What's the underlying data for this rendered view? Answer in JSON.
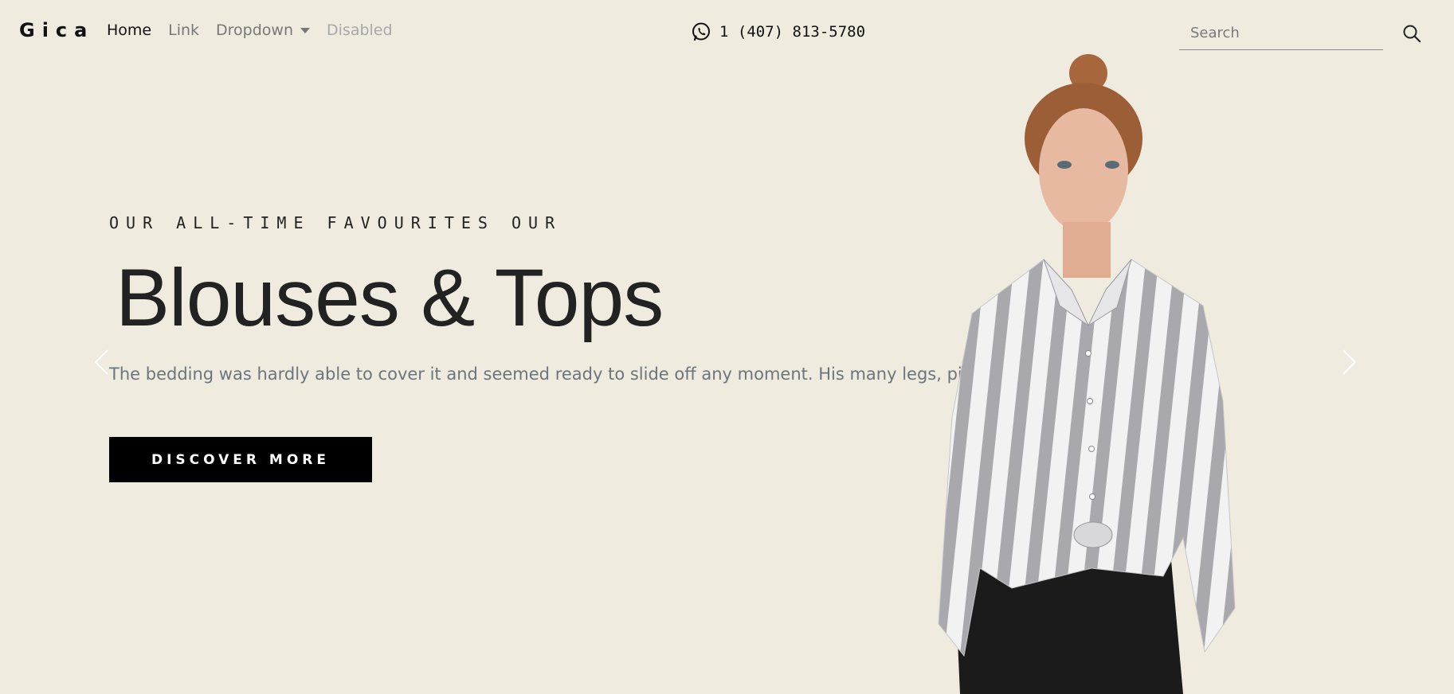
{
  "navbar": {
    "brand": "Gica",
    "links": [
      {
        "label": "Home",
        "state": "active"
      },
      {
        "label": "Link",
        "state": "normal"
      },
      {
        "label": "Dropdown",
        "state": "dropdown"
      },
      {
        "label": "Disabled",
        "state": "disabled"
      }
    ],
    "phone": "1 (407) 813-5780",
    "phone_icon": "whatsapp-icon",
    "search": {
      "placeholder": "Search",
      "value": ""
    },
    "search_icon": "search-icon"
  },
  "hero": {
    "eyebrow": "OUR ALL-TIME FAVOURITES OUR",
    "title": "Blouses & Tops",
    "description": "The bedding was hardly able to cover it and seemed ready to slide off any moment. His many legs, pit",
    "cta_label": "DISCOVER MORE",
    "prev_icon": "chevron-left-icon",
    "next_icon": "chevron-right-icon",
    "image": "model-striped-shirt"
  },
  "colors": {
    "background": "#efebdf",
    "text": "#222222",
    "muted": "#6c757d",
    "button_bg": "#000000",
    "button_text": "#ffffff"
  }
}
